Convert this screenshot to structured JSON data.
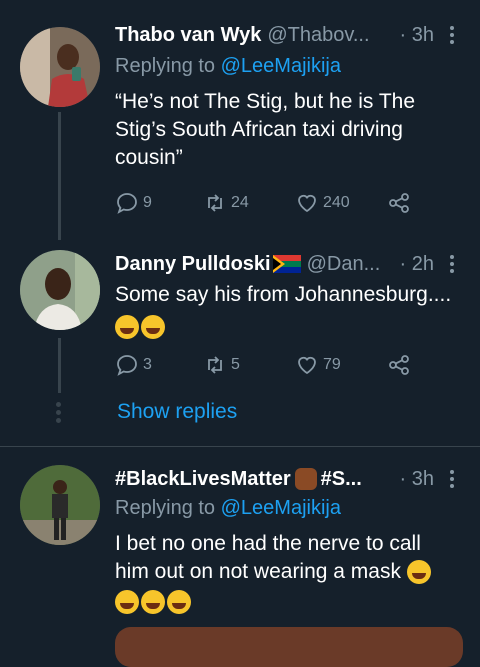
{
  "tweets": [
    {
      "display_name": "Thabo van Wyk",
      "handle": "@Thabov...",
      "time": "· 3h",
      "replying_prefix": "Replying to ",
      "replying_handle": "@LeeMajikija",
      "text_lines": [
        "“He’s not The Stig, but he is The",
        "Stig’s South African taxi driving",
        "cousin”"
      ],
      "replies": "9",
      "retweets": "24",
      "likes": "240"
    },
    {
      "display_name": "Danny Pulldoski",
      "handle": "@Dan...",
      "time": "· 2h",
      "text_lines": [
        "Some say his from Johannesburg...."
      ],
      "replies": "3",
      "retweets": "5",
      "likes": "79",
      "show_replies": "Show replies"
    },
    {
      "display_name": "#BlackLivesMatter",
      "display_name_suffix": "#S...",
      "time": "· 3h",
      "replying_prefix": "Replying to ",
      "replying_handle": "@LeeMajikija",
      "text_lines": [
        "I bet no one had the nerve to call",
        "him out on not wearing a mask"
      ]
    }
  ],
  "colors": {
    "background": "#15202b",
    "accent": "#1da1f2",
    "secondary_text": "#8899a6",
    "divider": "#38444d"
  },
  "icons": [
    "reply-icon",
    "retweet-icon",
    "like-icon",
    "share-icon",
    "more-icon"
  ]
}
